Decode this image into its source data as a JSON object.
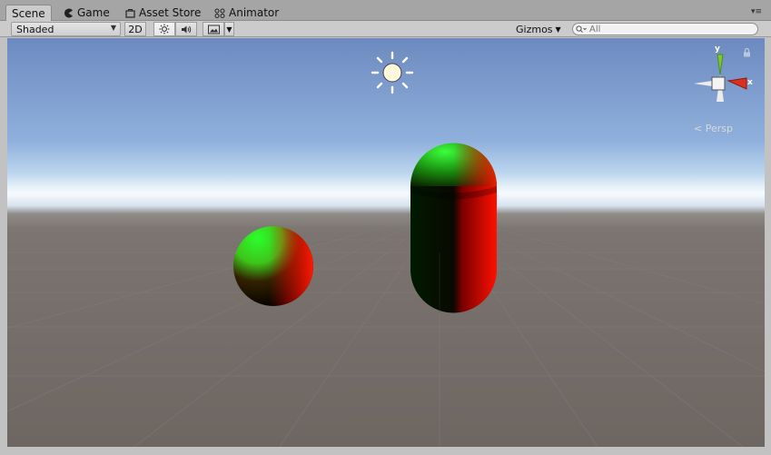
{
  "tabs": [
    {
      "label": "Scene",
      "icon": "none",
      "active": true
    },
    {
      "label": "Game",
      "icon": "pacman-icon",
      "active": false
    },
    {
      "label": "Asset Store",
      "icon": "shopping-bag-icon",
      "active": false
    },
    {
      "label": "Animator",
      "icon": "animator-icon",
      "active": false
    }
  ],
  "toolbar": {
    "draw_mode": "Shaded",
    "mode_2d": "2D",
    "gizmos": "Gizmos",
    "search_placeholder": "All"
  },
  "viewport": {
    "projection_label": "< Persp",
    "axis_y": "y",
    "axis_x": "x"
  },
  "colors": {
    "axis_y": "#7cc63a",
    "axis_x": "#d9301f",
    "sky_top": "#6d8ac0",
    "horizon": "#f7fbff",
    "ground": "#6e6661"
  }
}
